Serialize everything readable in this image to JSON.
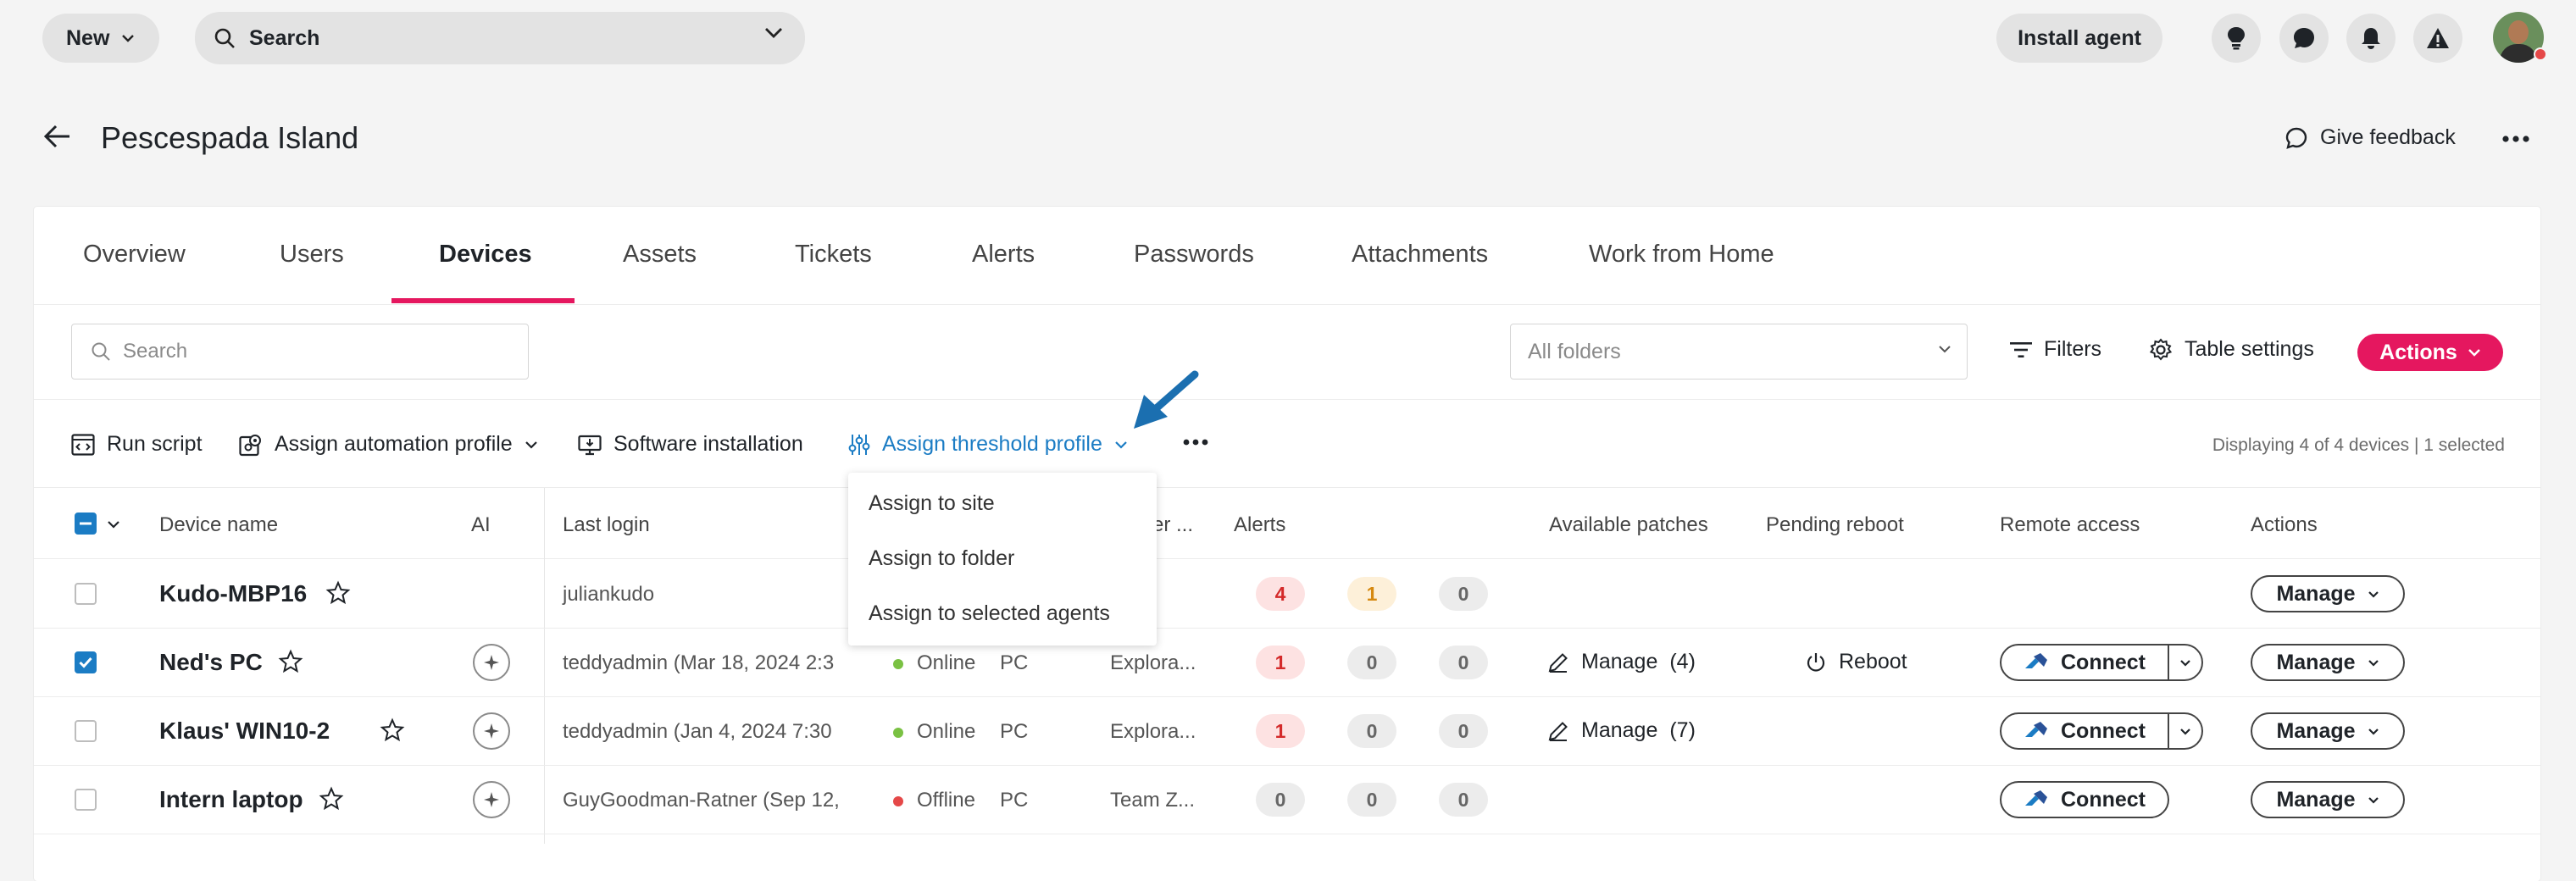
{
  "topbar": {
    "new_label": "New",
    "search_label": "Search",
    "install_label": "Install agent",
    "icons": [
      "lightbulb-icon",
      "chat-icon",
      "bell-icon",
      "warning-icon"
    ]
  },
  "page": {
    "title": "Pescespada Island",
    "feedback_label": "Give feedback"
  },
  "tabs": [
    "Overview",
    "Users",
    "Devices",
    "Assets",
    "Tickets",
    "Alerts",
    "Passwords",
    "Attachments",
    "Work from Home"
  ],
  "active_tab": "Devices",
  "filters": {
    "search_placeholder": "Search",
    "folders_label": "All folders",
    "filters_label": "Filters",
    "table_settings_label": "Table settings",
    "actions_label": "Actions"
  },
  "toolbar": {
    "run_script": "Run script",
    "assign_automation": "Assign automation profile",
    "software_installation": "Software installation",
    "assign_threshold": "Assign threshold profile",
    "displaying": "Displaying 4 of 4 devices | 1 selected"
  },
  "dropdown": [
    "Assign to site",
    "Assign to folder",
    "Assign to selected agents"
  ],
  "columns": {
    "device_name": "Device name",
    "ai": "AI",
    "last_login": "Last login",
    "partial": "er ...",
    "alerts": "Alerts",
    "available_patches": "Available patches",
    "pending_reboot": "Pending reboot",
    "remote_access": "Remote access",
    "actions": "Actions"
  },
  "rows": [
    {
      "name": "Kudo-MBP16",
      "last_login": "juliankudo",
      "status": "",
      "type": "",
      "group": "",
      "alerts": [
        "4",
        "1",
        "0"
      ],
      "patches": "",
      "reboot": "",
      "connect": "",
      "manage": "Manage"
    },
    {
      "name": "Ned's PC",
      "last_login": "teddyadmin (Mar 18, 2024 2:3",
      "status": "Online",
      "type": "PC",
      "group": "Explora...",
      "alerts": [
        "1",
        "0",
        "0"
      ],
      "patches": "Manage",
      "patches_count": "(4)",
      "reboot": "Reboot",
      "connect": "Connect",
      "manage": "Manage"
    },
    {
      "name": "Klaus' WIN10-2",
      "last_login": "teddyadmin (Jan 4, 2024 7:30",
      "status": "Online",
      "type": "PC",
      "group": "Explora...",
      "alerts": [
        "1",
        "0",
        "0"
      ],
      "patches": "Manage",
      "patches_count": "(7)",
      "reboot": "",
      "connect": "Connect",
      "manage": "Manage"
    },
    {
      "name": "Intern laptop",
      "last_login": "GuyGoodman-Ratner (Sep 12,",
      "status": "Offline",
      "type": "PC",
      "group": "Team Z...",
      "alerts": [
        "0",
        "0",
        "0"
      ],
      "patches": "",
      "reboot": "",
      "connect": "Connect",
      "manage": "Manage"
    }
  ],
  "colors": {
    "accent": "#e5175f",
    "link": "#1b7cc4",
    "online": "#7ac143",
    "offline": "#e54848"
  }
}
